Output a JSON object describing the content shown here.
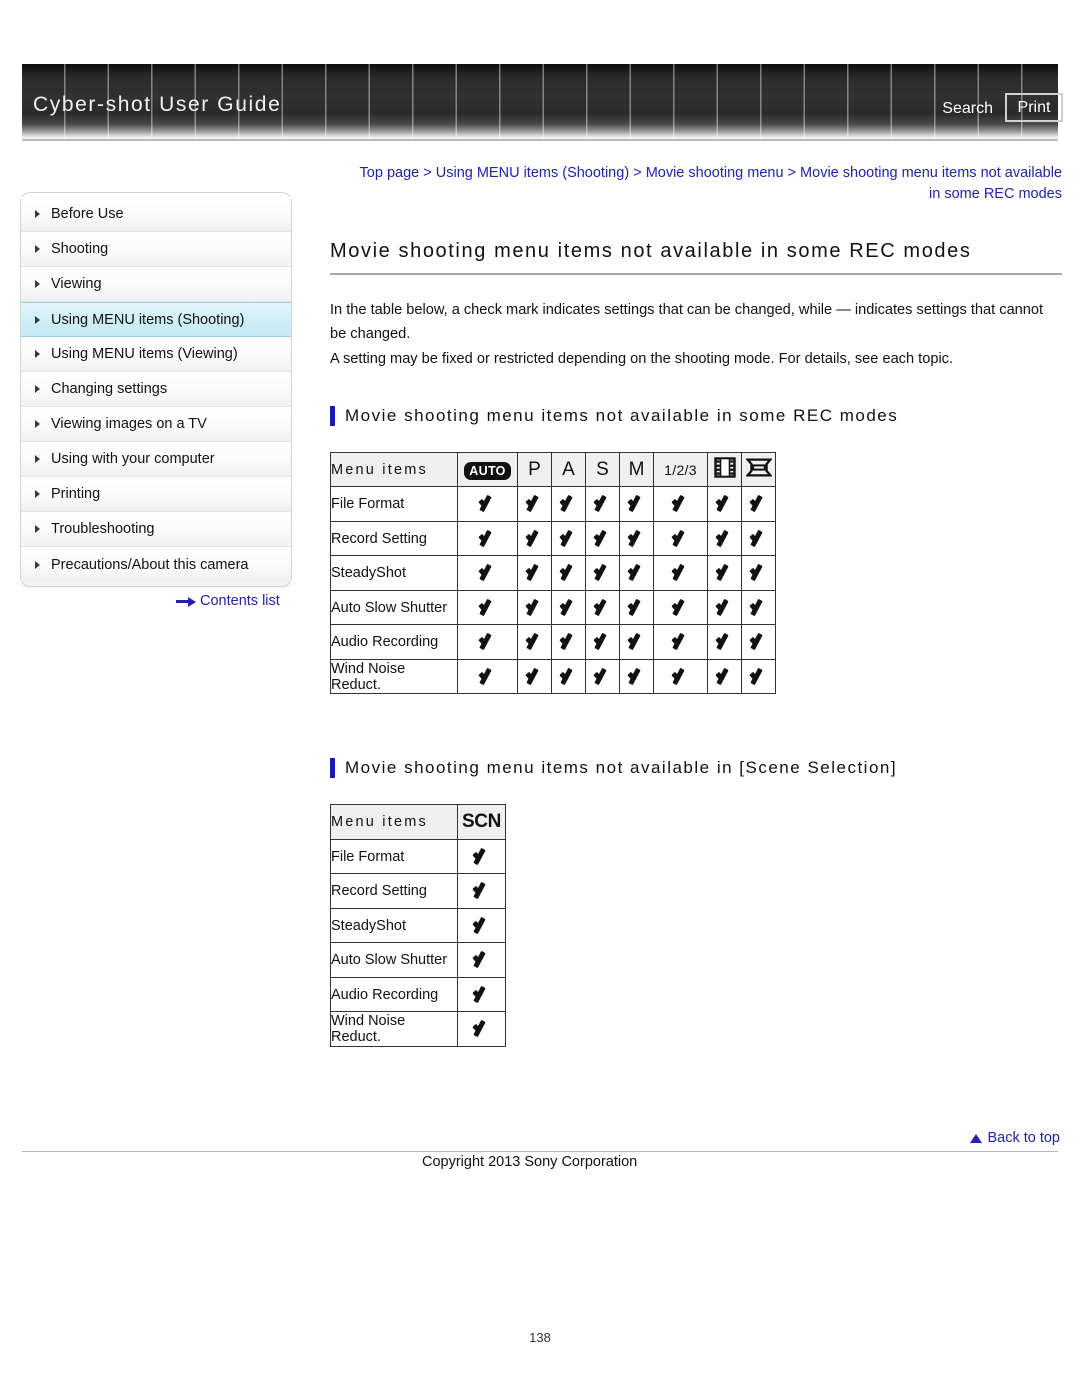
{
  "header": {
    "brand_title": "Cyber-shot User Guide",
    "search_label": "Search",
    "print_label": "Print"
  },
  "breadcrumb": {
    "items": [
      "Top page",
      "Using MENU items (Shooting)",
      "Movie shooting menu",
      "Movie shooting menu items not available in some REC modes"
    ],
    "separator": ">"
  },
  "sidebar": {
    "items": [
      {
        "label": "Before Use",
        "active": false
      },
      {
        "label": "Shooting",
        "active": false
      },
      {
        "label": "Viewing",
        "active": false
      },
      {
        "label": "Using MENU items (Shooting)",
        "active": true
      },
      {
        "label": "Using MENU items (Viewing)",
        "active": false
      },
      {
        "label": "Changing settings",
        "active": false
      },
      {
        "label": "Viewing images on a TV",
        "active": false
      },
      {
        "label": "Using with your computer",
        "active": false
      },
      {
        "label": "Printing",
        "active": false
      },
      {
        "label": "Troubleshooting",
        "active": false
      },
      {
        "label": "Precautions/About this camera",
        "active": false
      }
    ],
    "contents_list_label": "Contents list"
  },
  "main": {
    "page_title": "Movie shooting menu items not available in some REC modes",
    "intro_paragraph_1": "In the table below, a check mark indicates settings that can be changed, while — indicates settings that cannot be changed.",
    "intro_paragraph_2": "A setting may be fixed or restricted depending on the shooting mode. For details, see each topic.",
    "section1": {
      "heading": "Movie shooting menu items not available in some REC modes",
      "menu_items_header": "Menu items",
      "mode_columns": [
        {
          "type": "auto",
          "label": "AUTO"
        },
        {
          "type": "letter",
          "label": "P"
        },
        {
          "type": "letter",
          "label": "A"
        },
        {
          "type": "letter",
          "label": "S"
        },
        {
          "type": "letter",
          "label": "M"
        },
        {
          "type": "text",
          "label": "1/2/3"
        },
        {
          "type": "film",
          "label": "movie-mode"
        },
        {
          "type": "pano",
          "label": "sweep-panorama-mode"
        }
      ],
      "rows": [
        {
          "label": "File Format",
          "marks": [
            "check",
            "check",
            "check",
            "check",
            "check",
            "check",
            "check",
            "check"
          ]
        },
        {
          "label": "Record Setting",
          "marks": [
            "check",
            "check",
            "check",
            "check",
            "check",
            "check",
            "check",
            "check"
          ]
        },
        {
          "label": "SteadyShot",
          "marks": [
            "check",
            "check",
            "check",
            "check",
            "check",
            "check",
            "check",
            "check"
          ]
        },
        {
          "label": "Auto Slow Shutter",
          "marks": [
            "check",
            "check",
            "check",
            "check",
            "check",
            "check",
            "check",
            "check"
          ]
        },
        {
          "label": "Audio Recording",
          "marks": [
            "check",
            "check",
            "check",
            "check",
            "check",
            "check",
            "check",
            "check"
          ]
        },
        {
          "label": "Wind Noise Reduct.",
          "marks": [
            "check",
            "check",
            "check",
            "check",
            "check",
            "check",
            "check",
            "check"
          ]
        }
      ]
    },
    "section2": {
      "heading": "Movie shooting menu items not available in [Scene Selection]",
      "menu_items_header": "Menu items",
      "mode_columns": [
        {
          "type": "scn",
          "label": "SCN"
        }
      ],
      "rows": [
        {
          "label": "File Format",
          "marks": [
            "check"
          ]
        },
        {
          "label": "Record Setting",
          "marks": [
            "check"
          ]
        },
        {
          "label": "SteadyShot",
          "marks": [
            "check"
          ]
        },
        {
          "label": "Auto Slow Shutter",
          "marks": [
            "check"
          ]
        },
        {
          "label": "Audio Recording",
          "marks": [
            "check"
          ]
        },
        {
          "label": "Wind Noise Reduct.",
          "marks": [
            "check"
          ]
        }
      ]
    }
  },
  "footer": {
    "back_to_top_label": "Back to top",
    "copyright": "Copyright 2013 Sony Corporation",
    "page_number": "138"
  },
  "colors": {
    "link": "#2222aa",
    "accent_bar": "#1a1ab0",
    "sidebar_active": "#cfeef7",
    "table_header_bg": "#efefef"
  }
}
